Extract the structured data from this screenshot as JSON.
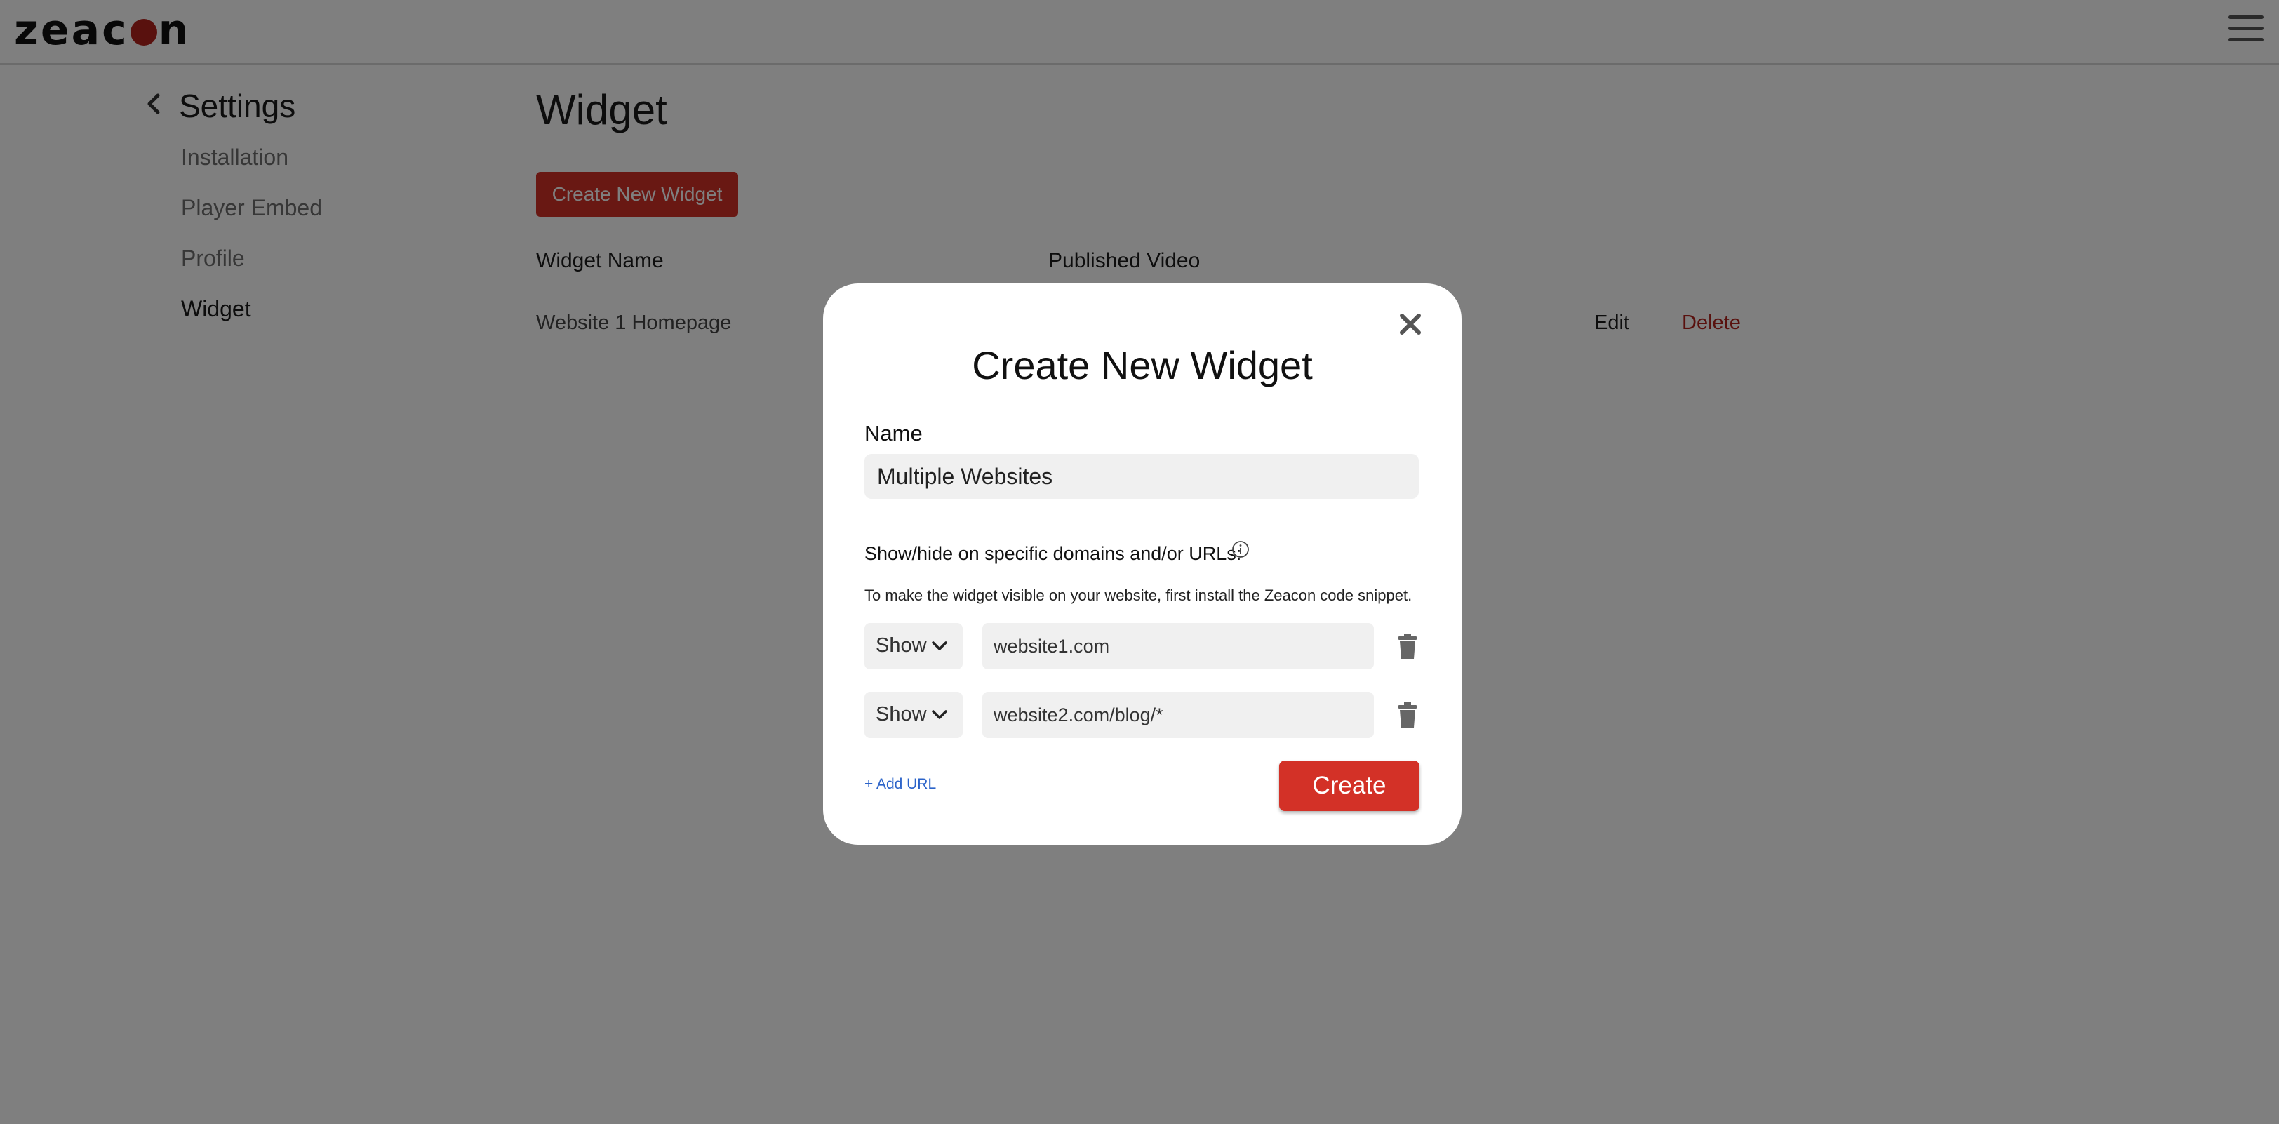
{
  "brand": {
    "logo_text_before": "zeac",
    "logo_text_after": "n",
    "accent_color": "#d33127"
  },
  "header": {
    "menu_icon": "hamburger-menu-icon"
  },
  "sidebar": {
    "title": "Settings",
    "back_icon": "chevron-left-icon",
    "items": [
      {
        "label": "Installation",
        "active": false
      },
      {
        "label": "Player Embed",
        "active": false
      },
      {
        "label": "Profile",
        "active": false
      },
      {
        "label": "Widget",
        "active": true
      }
    ]
  },
  "main": {
    "title": "Widget",
    "create_button_label": "Create New Widget",
    "table": {
      "columns": [
        "Widget Name",
        "Published Video"
      ],
      "rows": [
        {
          "name": "Website 1 Homepage",
          "edit_label": "Edit",
          "delete_label": "Delete"
        }
      ]
    }
  },
  "modal": {
    "title": "Create New Widget",
    "close_icon": "close-icon",
    "name_label": "Name",
    "name_value": "Multiple Websites",
    "rules_label": "Show/hide on specific domains and/or URLs:",
    "info_icon": "info-icon",
    "helper_text": "To make the widget visible on your website, first install the Zeacon code snippet.",
    "rules": [
      {
        "mode": "Show",
        "url": "website1.com"
      },
      {
        "mode": "Show",
        "url": "website2.com/blog/*"
      }
    ],
    "add_url_label": "+ Add URL",
    "create_label": "Create"
  }
}
